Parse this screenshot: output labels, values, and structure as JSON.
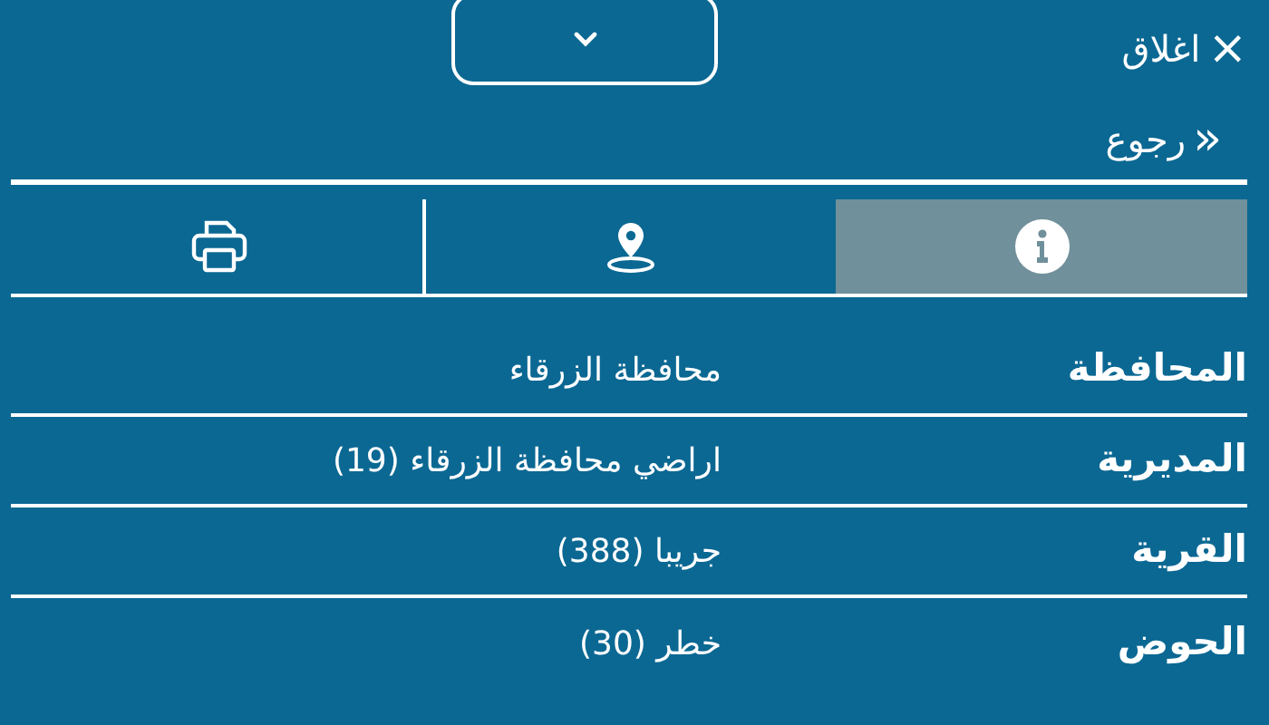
{
  "header": {
    "close": {
      "icon": "×",
      "label": "اغلاق"
    },
    "back": {
      "icon": "«",
      "label": "رجوع"
    }
  },
  "tabs": [
    {
      "kind": "info",
      "selected": true
    },
    {
      "kind": "location",
      "selected": false
    },
    {
      "kind": "print",
      "selected": false
    }
  ],
  "details": [
    {
      "label": "المحافظة",
      "value": "محافظة الزرقاء"
    },
    {
      "label": "المديرية",
      "value": "اراضي محافظة الزرقاء (19)"
    },
    {
      "label": "القرية",
      "value": "جريبا (388)"
    },
    {
      "label": "الحوض",
      "value": "خطر (30)"
    }
  ]
}
